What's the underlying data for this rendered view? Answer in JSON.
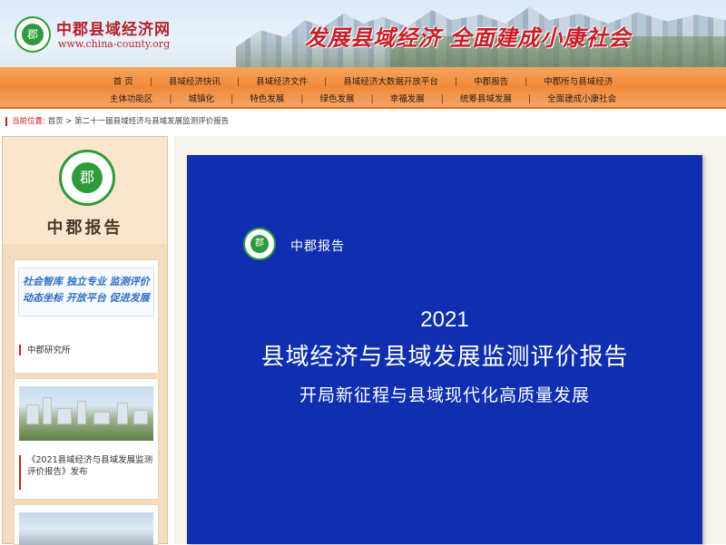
{
  "header": {
    "site_name": "中郡县域经济网",
    "site_url": "www.china-county.org",
    "logo_char": "郡",
    "slogan": "发展县域经济  全面建成小康社会"
  },
  "nav": {
    "row1": [
      "首 页",
      "县域经济快讯",
      "县域经济文件",
      "县域经济大数据开放平台",
      "中郡报告",
      "中郡所与县域经济"
    ],
    "row2": [
      "主体功能区",
      "城镇化",
      "特色发展",
      "绿色发展",
      "幸福发展",
      "统筹县域发展",
      "全面建成小康社会"
    ]
  },
  "breadcrumb": {
    "label": "当前位置:",
    "home": "首页",
    "separator": ">",
    "current": "第二十一届县域经济与县域发展监测评价报告"
  },
  "sidebar": {
    "logo_char": "郡",
    "title": "中郡报告",
    "cards": [
      {
        "slogan_lines": [
          "社会智库 独立专业 监测评价",
          "动态坐标 开放平台 促进发展"
        ],
        "caption": "中郡研究所"
      },
      {
        "caption": "《2021县域经济与县域发展监测评价报告》发布"
      },
      {
        "caption": ""
      }
    ]
  },
  "cover": {
    "logo_char": "郡",
    "brand": "中郡报告",
    "year": "2021",
    "title": "县域经济与县域发展监测评价报告",
    "subtitle": "开局新征程与县域现代化高质量发展"
  },
  "colors": {
    "brand_red": "#c81f26",
    "nav_orange": "#f08a3a",
    "cover_blue": "#0f2fb0",
    "logo_green": "#2f9a3a"
  }
}
